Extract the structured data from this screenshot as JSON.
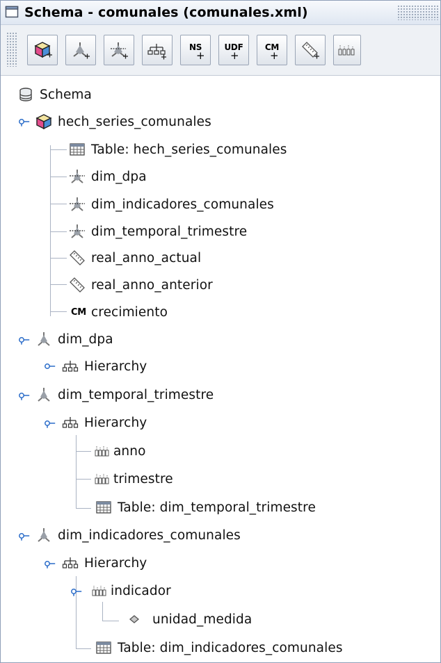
{
  "window": {
    "title": "Schema - comunales (comunales.xml)"
  },
  "toolbar": {
    "buttons": [
      {
        "name": "add-cube",
        "icon": "cube-add-icon",
        "text": ""
      },
      {
        "name": "add-dimension",
        "icon": "dimension-add-icon",
        "text": ""
      },
      {
        "name": "add-dimension-usage",
        "icon": "dimension-usage-add-icon",
        "text": ""
      },
      {
        "name": "add-hierarchy",
        "icon": "hierarchy-add-icon",
        "text": ""
      },
      {
        "name": "add-named-set",
        "icon": "named-set-add-icon",
        "text": "NS"
      },
      {
        "name": "add-udf",
        "icon": "udf-add-icon",
        "text": "UDF"
      },
      {
        "name": "add-calculated-member",
        "icon": "calculated-member-add-icon",
        "text": "CM"
      },
      {
        "name": "add-measure",
        "icon": "measure-add-icon",
        "text": ""
      },
      {
        "name": "add-level",
        "icon": "level-add-icon",
        "text": ""
      }
    ]
  },
  "tree": {
    "root": "Schema",
    "cube": {
      "label": "hech_series_comunales",
      "table": "Table: hech_series_comunales",
      "dim_usages": [
        "dim_dpa",
        "dim_indicadores_comunales",
        "dim_temporal_trimestre"
      ],
      "measures": [
        "real_anno_actual",
        "real_anno_anterior"
      ],
      "calc_member": "crecimiento",
      "cm_badge": "CM"
    },
    "dim1": {
      "label": "dim_dpa",
      "hierarchy": "Hierarchy"
    },
    "dim2": {
      "label": "dim_temporal_trimestre",
      "hierarchy": "Hierarchy",
      "levels": [
        "anno",
        "trimestre"
      ],
      "table": "Table: dim_temporal_trimestre"
    },
    "dim3": {
      "label": "dim_indicadores_comunales",
      "hierarchy": "Hierarchy",
      "level": "indicador",
      "property": "unidad_medida",
      "table": "Table: dim_indicadores_comunales"
    }
  },
  "colors": {
    "tree_line": "#aab3c3",
    "handle": "#2a6cc9",
    "cube": "#e6cf74"
  }
}
